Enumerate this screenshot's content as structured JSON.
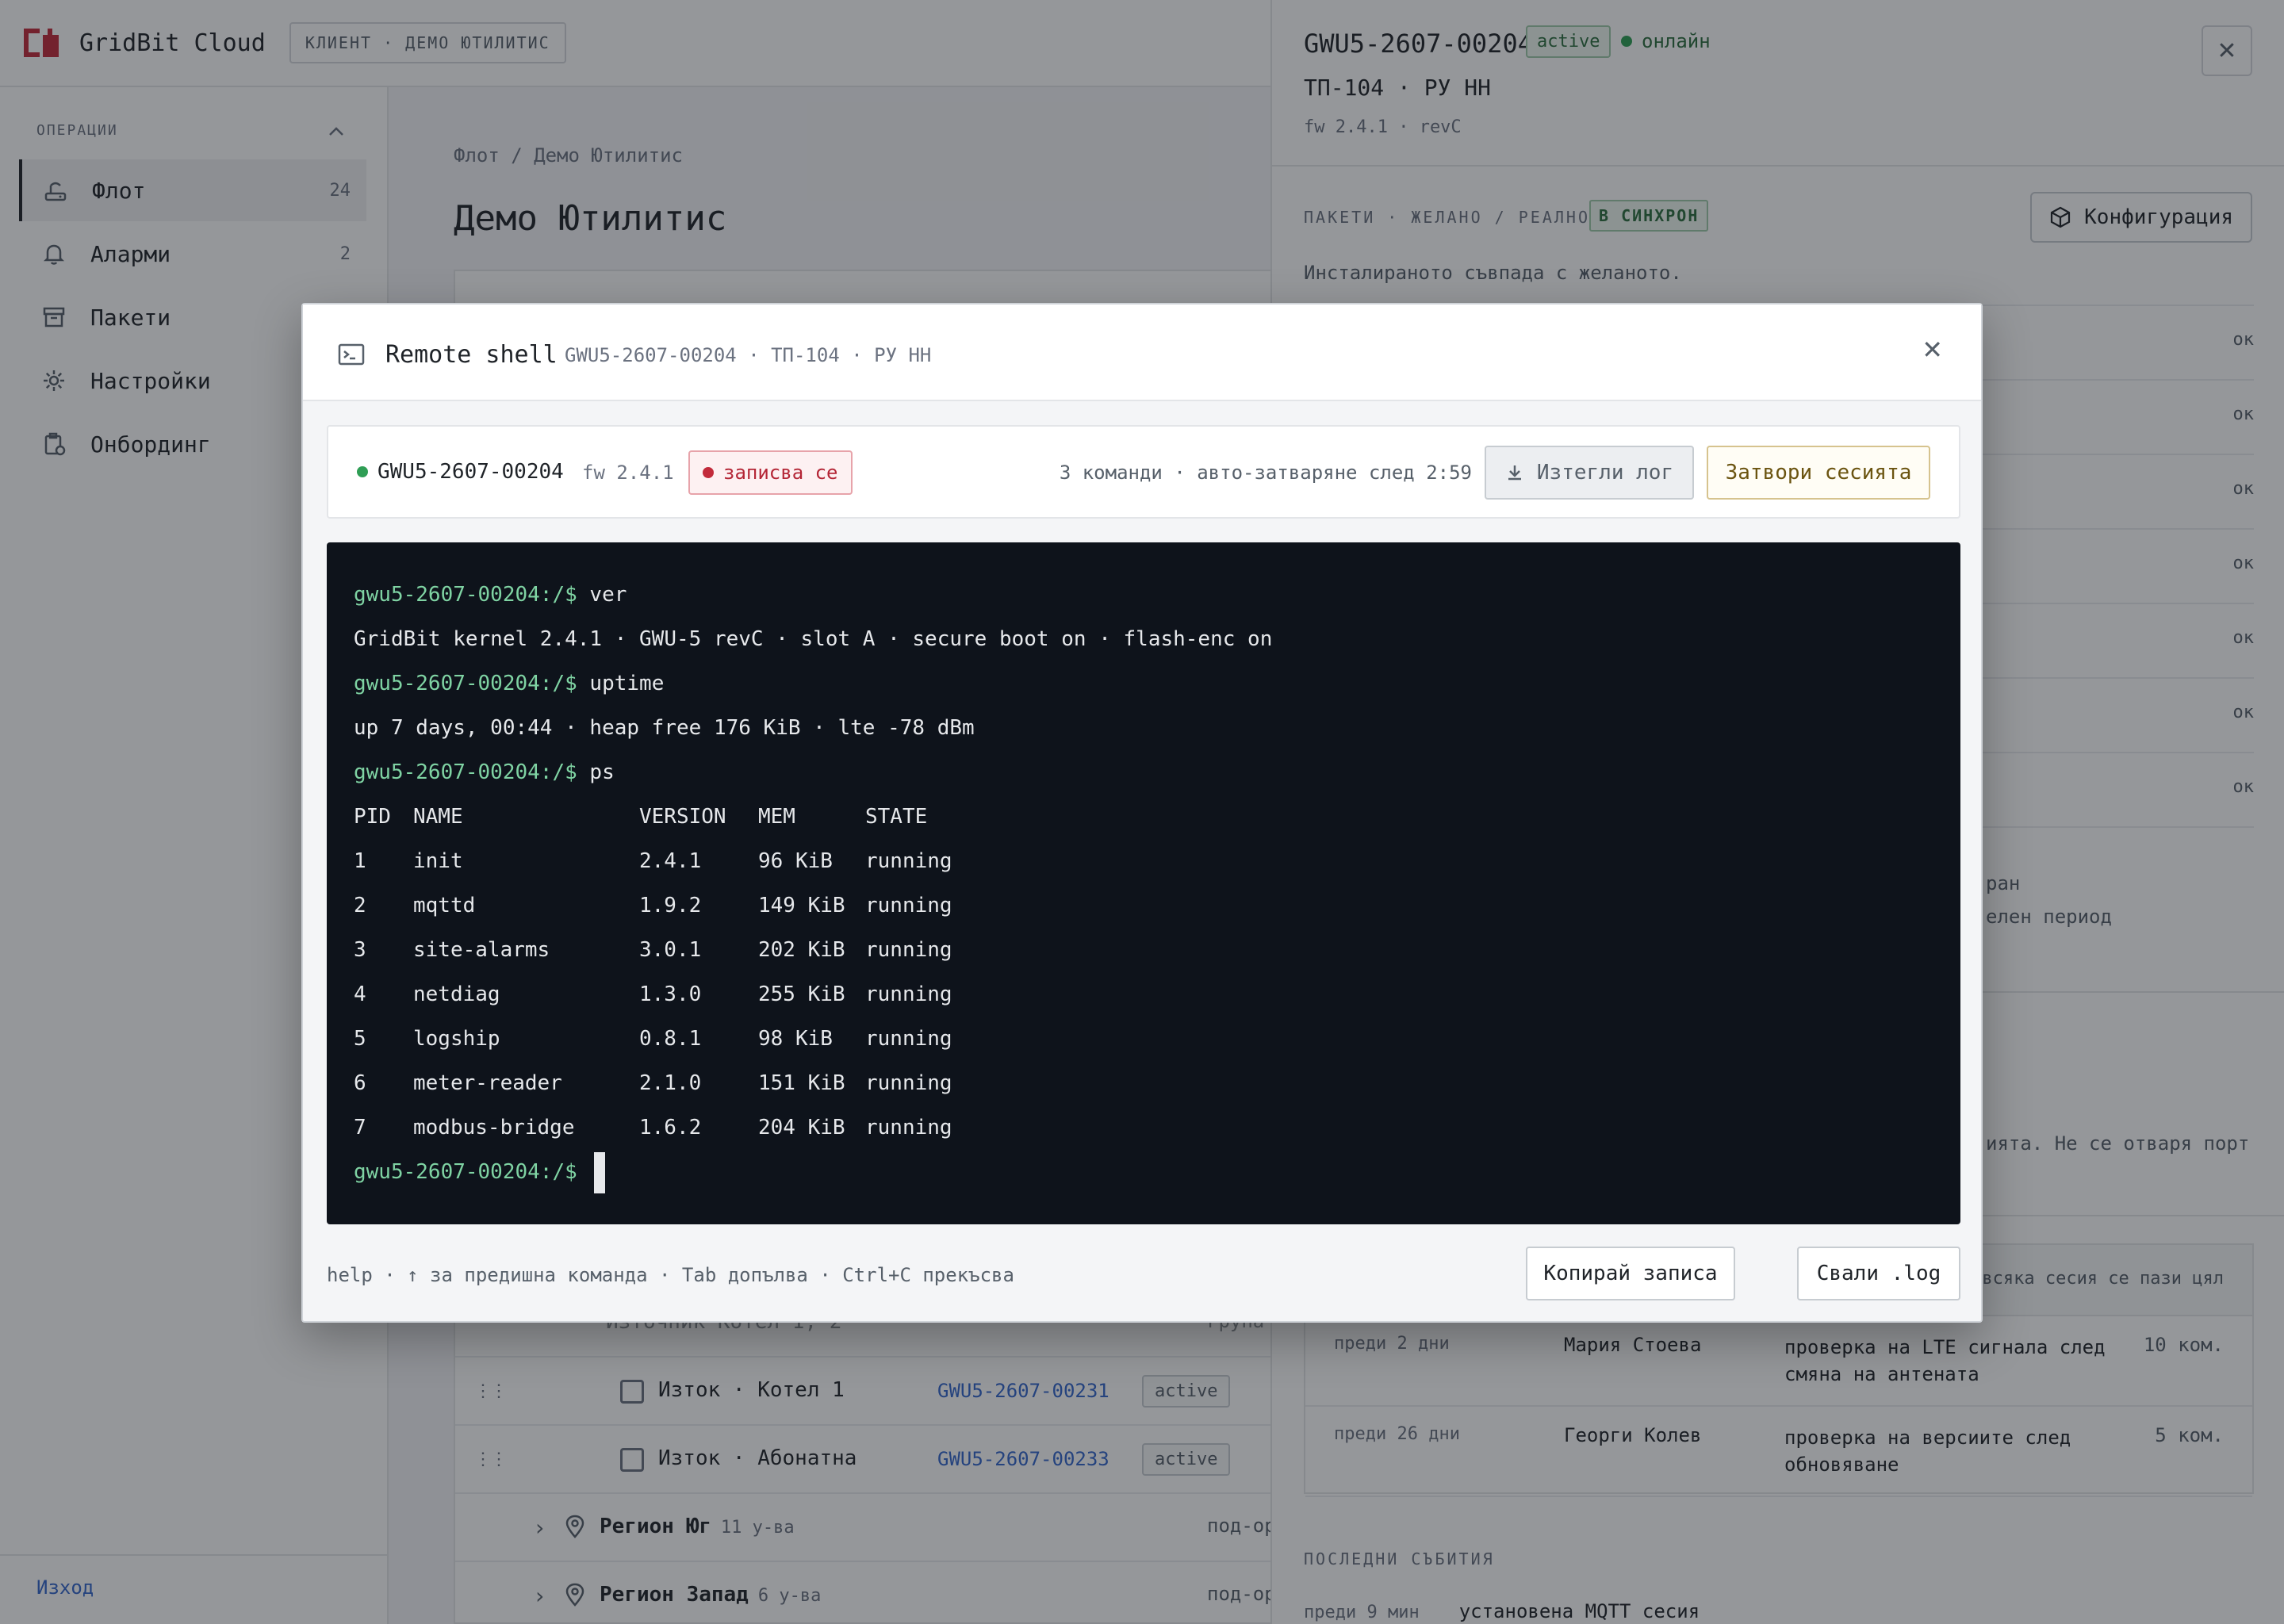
{
  "app": {
    "brand": "GridBit Cloud",
    "client_chip": "КЛИЕНТ · ДЕМО ЮТИЛИТИС"
  },
  "sidebar": {
    "section_label": "ОПЕРАЦИИ",
    "items": [
      {
        "label": "Флот",
        "count": "24",
        "icon": "router-icon"
      },
      {
        "label": "Аларми",
        "count": "2",
        "icon": "bell-icon"
      },
      {
        "label": "Пакети",
        "count": "",
        "icon": "archive-icon"
      },
      {
        "label": "Настройки",
        "count": "",
        "icon": "gear-icon"
      },
      {
        "label": "Онбординг",
        "count": "",
        "icon": "clipboard-icon"
      }
    ],
    "logout": "Изход"
  },
  "main": {
    "breadcrumb": "Флот / Демо Ютилитис",
    "title": "Демо Ютилитис",
    "rows": [
      {
        "name": "Източник Котел 1, 2",
        "type": "група"
      },
      {
        "name": "Изток · Котел 1",
        "id": "GWU5-2607-00231",
        "status": "active"
      },
      {
        "name": "Изток · Абонатна",
        "id": "GWU5-2607-00233",
        "status": "active"
      }
    ],
    "regions": [
      {
        "name": "Регион Юг",
        "count": "11 у-ва",
        "type": "под-организ"
      },
      {
        "name": "Регион Запад",
        "count": "6 у-ва",
        "type": "под-организ"
      }
    ]
  },
  "panel": {
    "device_id": "GWU5-2607-00204",
    "status": "active",
    "connection": "онлайн",
    "location": "ТП-104 · РУ НН",
    "firmware": "fw 2.4.1 · revC",
    "packages_label": "ПАКЕТИ · ЖЕЛАНО / РЕАЛНО",
    "sync_chip": "В СИНХРОН",
    "config_button": "Конфигурация",
    "packages_note": "Инсталираното съвпада с желаното.",
    "package_status": [
      "ок",
      "ок",
      "ок",
      "ок",
      "ок",
      "ок",
      "ок"
    ],
    "partial_text_1": "ран",
    "partial_text_2": "елен период",
    "partial_text_3": "ията. Не се отваря порт",
    "sessions_header_note": "всяка сесия се пази цял",
    "sessions": [
      {
        "when": "преди 2 дни",
        "user": "Мария Стоева",
        "reason": "проверка на LTE сигнала след смяна на антената",
        "commands": "10 ком."
      },
      {
        "when": "преди 26 дни",
        "user": "Георги Колев",
        "reason": "проверка на версиите след обновяване",
        "commands": "5 ком."
      }
    ],
    "events_label": "ПОСЛЕДНИ СЪБИТИЯ",
    "event": {
      "when": "преди 9 мин",
      "text": "установена MQTT сесия"
    }
  },
  "modal": {
    "title": "Remote shell",
    "subtitle": "GWU5-2607-00204 · ТП-104 · РУ НН",
    "device": "GWU5-2607-00204",
    "fw": "fw 2.4.1",
    "recording": "записва се",
    "meta": "3 команди · авто-затваряне след 2:59",
    "download_log": "Изтегли лог",
    "close_session": "Затвори сесията",
    "hint": "help · ↑ за предишна команда · Tab допълва · Ctrl+C прекъсва",
    "copy_record": "Копирай записа",
    "download_file": "Свали .log"
  },
  "terminal": {
    "prompt": "gwu5-2607-00204:/$",
    "cmd1": "ver",
    "out1": "GridBit kernel 2.4.1 · GWU-5 revC · slot A · secure boot on · flash-enc on",
    "cmd2": "uptime",
    "out2": "up 7 days, 00:44 · heap free 176 KiB · lte -78 dBm",
    "cmd3": "ps",
    "ps_header": [
      "PID",
      "NAME",
      "VERSION",
      "MEM",
      "STATE"
    ],
    "ps_rows": [
      [
        "1",
        "init",
        "2.4.1",
        "96 KiB",
        "running"
      ],
      [
        "2",
        "mqttd",
        "1.9.2",
        "149 KiB",
        "running"
      ],
      [
        "3",
        "site-alarms",
        "3.0.1",
        "202 KiB",
        "running"
      ],
      [
        "4",
        "netdiag",
        "1.3.0",
        "255 KiB",
        "running"
      ],
      [
        "5",
        "logship",
        "0.8.1",
        "98 KiB",
        "running"
      ],
      [
        "6",
        "meter-reader",
        "2.1.0",
        "151 KiB",
        "running"
      ],
      [
        "7",
        "modbus-bridge",
        "1.6.2",
        "204 KiB",
        "running"
      ]
    ]
  }
}
